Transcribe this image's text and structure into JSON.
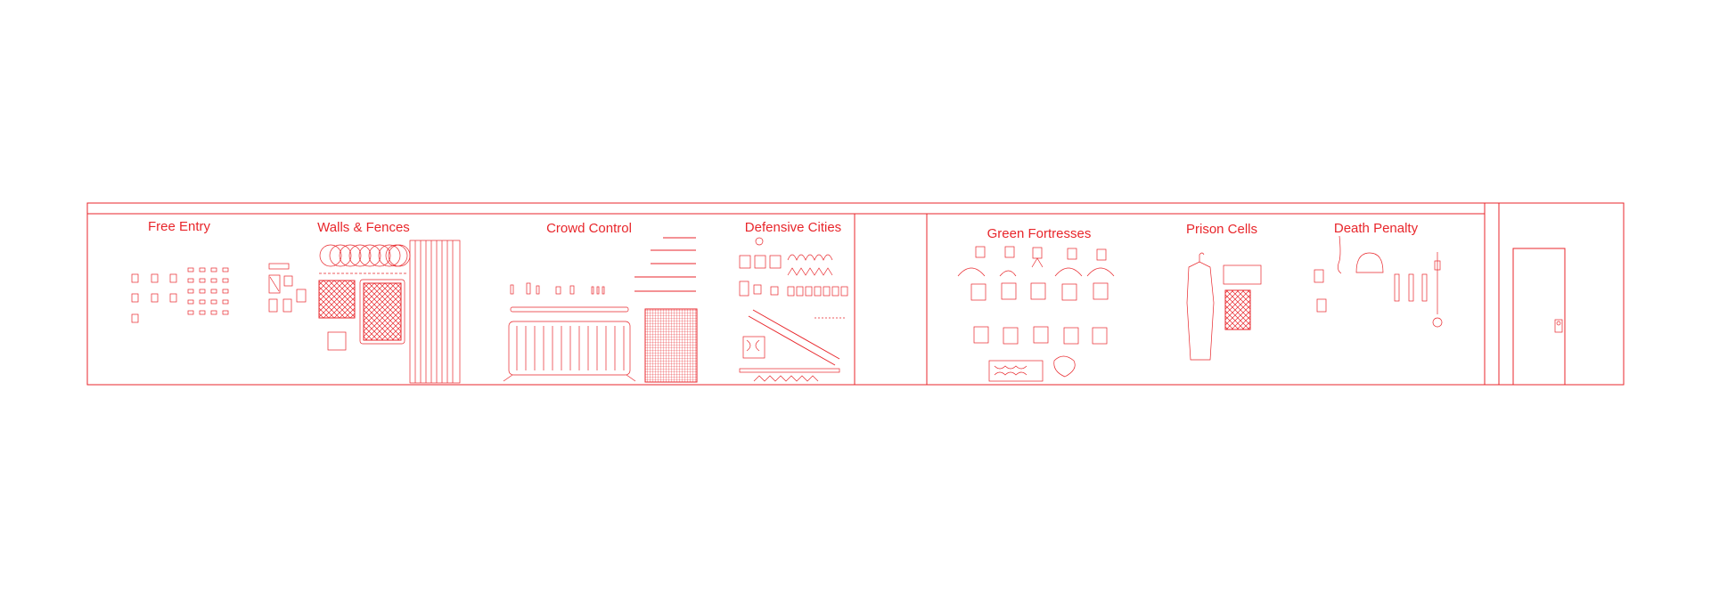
{
  "colors": {
    "line": "#e8262b",
    "background": "#ffffff"
  },
  "sections": [
    {
      "id": "free-entry",
      "title": "Free Entry"
    },
    {
      "id": "walls-fences",
      "title": "Walls & Fences"
    },
    {
      "id": "crowd-control",
      "title": "Crowd Control"
    },
    {
      "id": "defensive-cities",
      "title": "Defensive Cities"
    },
    {
      "id": "green-fortresses",
      "title": "Green Fortresses"
    },
    {
      "id": "prison-cells",
      "title": "Prison Cells"
    },
    {
      "id": "death-penalty",
      "title": "Death Penalty"
    }
  ]
}
